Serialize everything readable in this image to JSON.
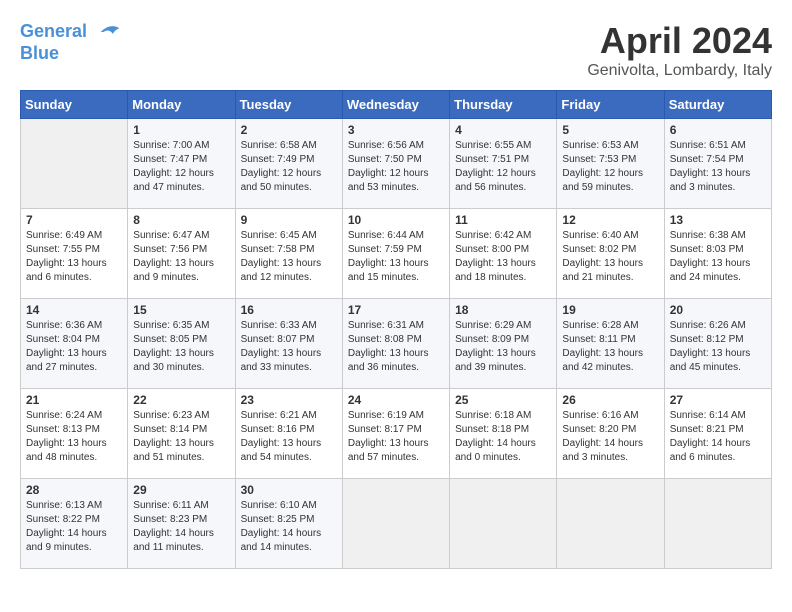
{
  "logo": {
    "line1": "General",
    "line2": "Blue"
  },
  "title": "April 2024",
  "subtitle": "Genivolta, Lombardy, Italy",
  "weekdays": [
    "Sunday",
    "Monday",
    "Tuesday",
    "Wednesday",
    "Thursday",
    "Friday",
    "Saturday"
  ],
  "weeks": [
    [
      {
        "day": "",
        "info": ""
      },
      {
        "day": "1",
        "info": "Sunrise: 7:00 AM\nSunset: 7:47 PM\nDaylight: 12 hours\nand 47 minutes."
      },
      {
        "day": "2",
        "info": "Sunrise: 6:58 AM\nSunset: 7:49 PM\nDaylight: 12 hours\nand 50 minutes."
      },
      {
        "day": "3",
        "info": "Sunrise: 6:56 AM\nSunset: 7:50 PM\nDaylight: 12 hours\nand 53 minutes."
      },
      {
        "day": "4",
        "info": "Sunrise: 6:55 AM\nSunset: 7:51 PM\nDaylight: 12 hours\nand 56 minutes."
      },
      {
        "day": "5",
        "info": "Sunrise: 6:53 AM\nSunset: 7:53 PM\nDaylight: 12 hours\nand 59 minutes."
      },
      {
        "day": "6",
        "info": "Sunrise: 6:51 AM\nSunset: 7:54 PM\nDaylight: 13 hours\nand 3 minutes."
      }
    ],
    [
      {
        "day": "7",
        "info": "Sunrise: 6:49 AM\nSunset: 7:55 PM\nDaylight: 13 hours\nand 6 minutes."
      },
      {
        "day": "8",
        "info": "Sunrise: 6:47 AM\nSunset: 7:56 PM\nDaylight: 13 hours\nand 9 minutes."
      },
      {
        "day": "9",
        "info": "Sunrise: 6:45 AM\nSunset: 7:58 PM\nDaylight: 13 hours\nand 12 minutes."
      },
      {
        "day": "10",
        "info": "Sunrise: 6:44 AM\nSunset: 7:59 PM\nDaylight: 13 hours\nand 15 minutes."
      },
      {
        "day": "11",
        "info": "Sunrise: 6:42 AM\nSunset: 8:00 PM\nDaylight: 13 hours\nand 18 minutes."
      },
      {
        "day": "12",
        "info": "Sunrise: 6:40 AM\nSunset: 8:02 PM\nDaylight: 13 hours\nand 21 minutes."
      },
      {
        "day": "13",
        "info": "Sunrise: 6:38 AM\nSunset: 8:03 PM\nDaylight: 13 hours\nand 24 minutes."
      }
    ],
    [
      {
        "day": "14",
        "info": "Sunrise: 6:36 AM\nSunset: 8:04 PM\nDaylight: 13 hours\nand 27 minutes."
      },
      {
        "day": "15",
        "info": "Sunrise: 6:35 AM\nSunset: 8:05 PM\nDaylight: 13 hours\nand 30 minutes."
      },
      {
        "day": "16",
        "info": "Sunrise: 6:33 AM\nSunset: 8:07 PM\nDaylight: 13 hours\nand 33 minutes."
      },
      {
        "day": "17",
        "info": "Sunrise: 6:31 AM\nSunset: 8:08 PM\nDaylight: 13 hours\nand 36 minutes."
      },
      {
        "day": "18",
        "info": "Sunrise: 6:29 AM\nSunset: 8:09 PM\nDaylight: 13 hours\nand 39 minutes."
      },
      {
        "day": "19",
        "info": "Sunrise: 6:28 AM\nSunset: 8:11 PM\nDaylight: 13 hours\nand 42 minutes."
      },
      {
        "day": "20",
        "info": "Sunrise: 6:26 AM\nSunset: 8:12 PM\nDaylight: 13 hours\nand 45 minutes."
      }
    ],
    [
      {
        "day": "21",
        "info": "Sunrise: 6:24 AM\nSunset: 8:13 PM\nDaylight: 13 hours\nand 48 minutes."
      },
      {
        "day": "22",
        "info": "Sunrise: 6:23 AM\nSunset: 8:14 PM\nDaylight: 13 hours\nand 51 minutes."
      },
      {
        "day": "23",
        "info": "Sunrise: 6:21 AM\nSunset: 8:16 PM\nDaylight: 13 hours\nand 54 minutes."
      },
      {
        "day": "24",
        "info": "Sunrise: 6:19 AM\nSunset: 8:17 PM\nDaylight: 13 hours\nand 57 minutes."
      },
      {
        "day": "25",
        "info": "Sunrise: 6:18 AM\nSunset: 8:18 PM\nDaylight: 14 hours\nand 0 minutes."
      },
      {
        "day": "26",
        "info": "Sunrise: 6:16 AM\nSunset: 8:20 PM\nDaylight: 14 hours\nand 3 minutes."
      },
      {
        "day": "27",
        "info": "Sunrise: 6:14 AM\nSunset: 8:21 PM\nDaylight: 14 hours\nand 6 minutes."
      }
    ],
    [
      {
        "day": "28",
        "info": "Sunrise: 6:13 AM\nSunset: 8:22 PM\nDaylight: 14 hours\nand 9 minutes."
      },
      {
        "day": "29",
        "info": "Sunrise: 6:11 AM\nSunset: 8:23 PM\nDaylight: 14 hours\nand 11 minutes."
      },
      {
        "day": "30",
        "info": "Sunrise: 6:10 AM\nSunset: 8:25 PM\nDaylight: 14 hours\nand 14 minutes."
      },
      {
        "day": "",
        "info": ""
      },
      {
        "day": "",
        "info": ""
      },
      {
        "day": "",
        "info": ""
      },
      {
        "day": "",
        "info": ""
      }
    ]
  ]
}
